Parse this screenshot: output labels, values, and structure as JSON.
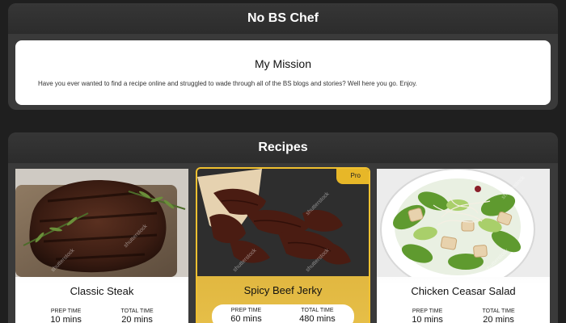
{
  "header": {
    "title": "No BS Chef"
  },
  "mission": {
    "title": "My Mission",
    "text": "Have you ever wanted to find a recipe online and struggled to wade through all of the BS blogs and stories? Well here you go. Enjoy."
  },
  "recipes": {
    "title": "Recipes",
    "items": [
      {
        "name": "Classic Steak",
        "prep_label": "PREP TIME",
        "prep": "10 mins",
        "total_label": "TOTAL TIME",
        "total": "20 mins",
        "badge": ""
      },
      {
        "name": "Spicy Beef Jerky",
        "prep_label": "PREP TIME",
        "prep": "60 mins",
        "total_label": "TOTAL TIME",
        "total": "480 mins",
        "badge": "Pro"
      },
      {
        "name": "Chicken Ceasar Salad",
        "prep_label": "PREP TIME",
        "prep": "10 mins",
        "total_label": "TOTAL TIME",
        "total": "20 mins",
        "badge": ""
      }
    ]
  },
  "watermark": "shutterstock",
  "colors": {
    "pro_accent": "#e7b728",
    "panel": "#3a3a3a",
    "background": "#1f1f1f"
  }
}
